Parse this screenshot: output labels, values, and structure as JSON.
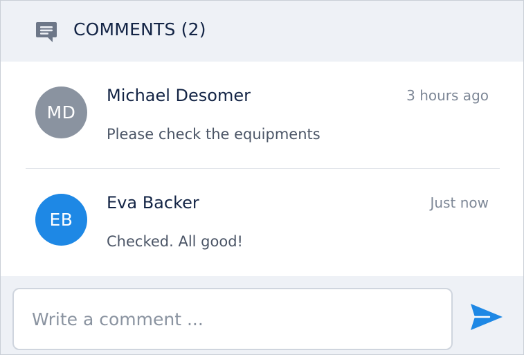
{
  "header": {
    "icon": "comment-icon",
    "title": "COMMENTS (2)"
  },
  "comments": [
    {
      "initials": "MD",
      "avatar_color": "#8a93a0",
      "name": "Michael Desomer",
      "time": "3 hours ago",
      "text": "Please check the equipments"
    },
    {
      "initials": "EB",
      "avatar_color": "#1e88e5",
      "name": "Eva Backer",
      "time": "Just now",
      "text": "Checked. All good!"
    }
  ],
  "composer": {
    "placeholder": "Write a comment ...",
    "value": "",
    "send_icon": "send-icon",
    "accent_color": "#1e88e5"
  },
  "colors": {
    "header_background": "#eef1f6",
    "title_text": "#132445",
    "secondary_text": "#7d8796"
  }
}
